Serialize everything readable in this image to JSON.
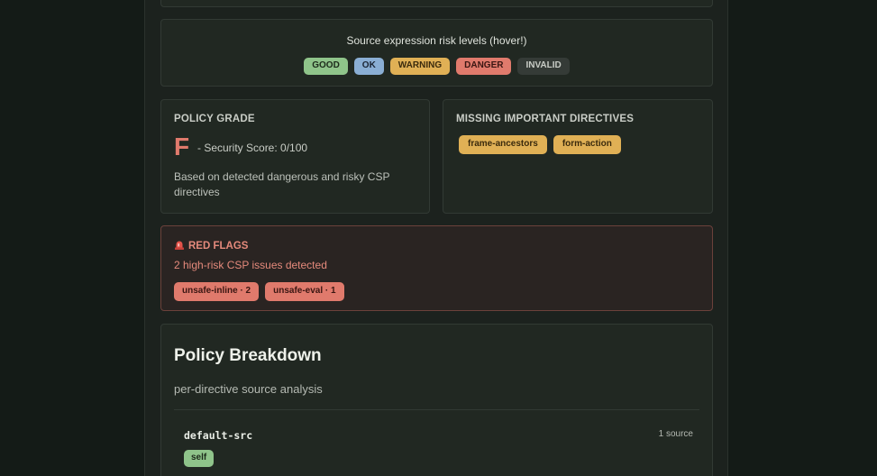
{
  "legend": {
    "title": "Source expression risk levels (hover!)",
    "levels": [
      {
        "label": "GOOD",
        "color": "#8fc48a"
      },
      {
        "label": "OK",
        "color": "#8aaed4"
      },
      {
        "label": "WARNING",
        "color": "#e0b055"
      },
      {
        "label": "DANGER",
        "color": "#e07a6c"
      },
      {
        "label": "INVALID",
        "color": "#353b37"
      }
    ]
  },
  "grade": {
    "label": "POLICY GRADE",
    "letter": "F",
    "score_text": "- Security Score: 0/100",
    "note": "Based on detected dangerous and risky CSP directives"
  },
  "missing": {
    "label": "MISSING IMPORTANT DIRECTIVES",
    "directives": [
      "frame-ancestors",
      "form-action"
    ]
  },
  "red_flags": {
    "icon": "siren-icon",
    "title": "RED FLAGS",
    "subtitle": "2 high-risk CSP issues detected",
    "items": [
      "unsafe-inline · 2",
      "unsafe-eval · 1"
    ]
  },
  "breakdown": {
    "title": "Policy Breakdown",
    "subtitle": "per-directive source analysis",
    "directives": [
      {
        "name": "default-src",
        "count": "1 source",
        "sources": [
          "self"
        ]
      }
    ]
  }
}
